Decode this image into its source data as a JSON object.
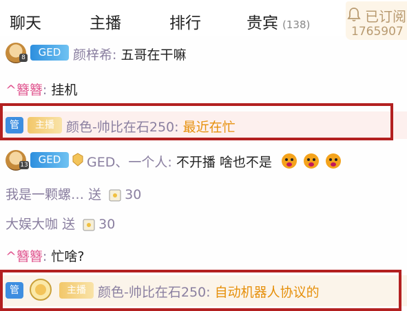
{
  "tabs": [
    {
      "label": "聊天"
    },
    {
      "label": "主播"
    },
    {
      "label": "排行"
    },
    {
      "label": "贵宾",
      "count": "(138)"
    }
  ],
  "subscribe": {
    "label": "已订阅",
    "count": "1765907"
  },
  "messages": [
    {
      "badge_level": "8",
      "badge": "GED",
      "name": "颜梓希",
      "sep": ":",
      "text": "五哥在干嘛"
    },
    {
      "name": "^簪簪",
      "sep": ":",
      "text": "挂机"
    },
    {
      "admin": "管",
      "anchor": "主播",
      "name": "颜色-帅比在石250",
      "sep": ":",
      "text": "最近在忙"
    },
    {
      "badge_level": "13",
      "badge": "GED",
      "name": "GED、一个人",
      "sep": ":",
      "text": "不开播   啥也不是"
    },
    {
      "name": "我是一颗螺…",
      "action": "送",
      "count": "30"
    },
    {
      "name": "大娱大咖",
      "action": "送",
      "count": "30"
    },
    {
      "name": "^簪簪",
      "sep": ":",
      "text": "忙啥?"
    },
    {
      "admin": "管",
      "anchor": "主播",
      "name": "颜色-帅比在石250",
      "sep": ":",
      "text": "自动机器人协议的"
    }
  ],
  "colors": {
    "highlight_frame": "#b32020",
    "ged_badge": "#2e8fde",
    "admin_badge": "#3e8ee0",
    "anchor_badge": "#f2c76a",
    "pink_name": "#e0558f",
    "orange_text": "#e6900c"
  },
  "icons": {
    "subscribe": "bell-icon",
    "emoji": "tiger-face-emoji",
    "gift": "gift-bag-icon",
    "fan": "fan-badge-icon"
  }
}
